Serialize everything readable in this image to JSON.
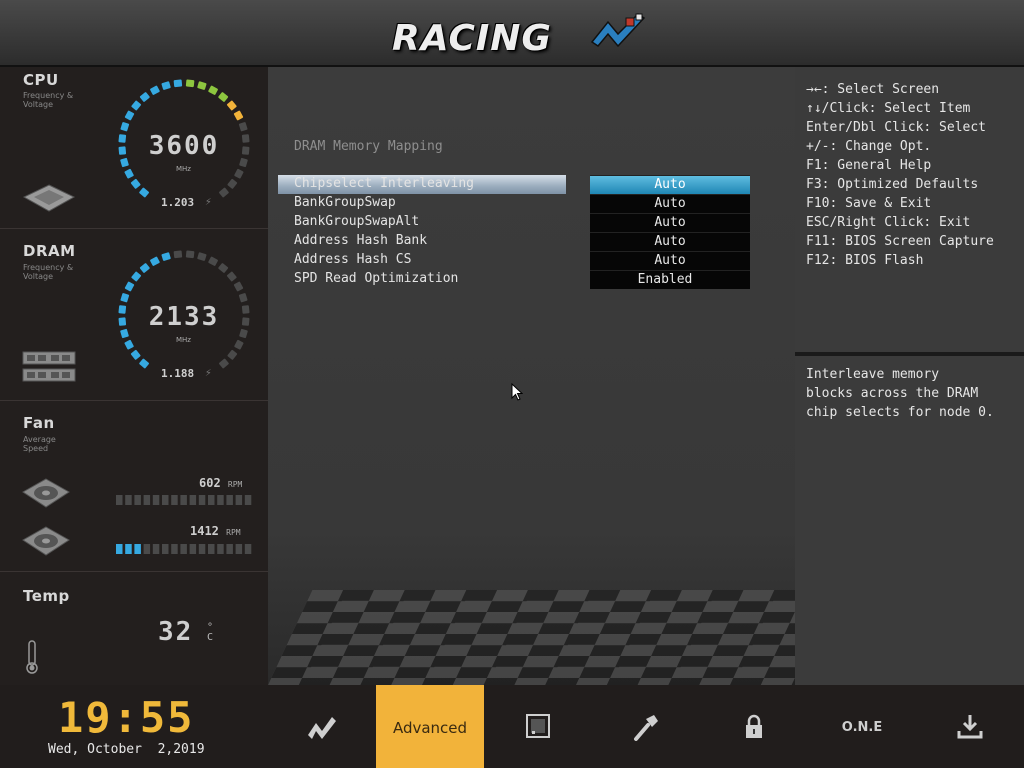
{
  "header": {
    "logo_text": "RACING",
    "logo_icon": "racing-flag-logo"
  },
  "sidebar": {
    "cpu": {
      "title": "CPU",
      "subtitle": "Frequency & Voltage",
      "value": "3600",
      "unit": "MHz",
      "voltage": "1.203",
      "level": 0.72
    },
    "dram": {
      "title": "DRAM",
      "subtitle": "Frequency & Voltage",
      "value": "2133",
      "unit": "MHz",
      "voltage": "1.188",
      "level": 0.45
    },
    "fan": {
      "title": "Fan",
      "subtitle": "Average Speed",
      "fans": [
        {
          "rpm": "602",
          "unit": "RPM",
          "level": 0.0
        },
        {
          "rpm": "1412",
          "unit": "RPM",
          "level": 0.2
        }
      ]
    },
    "temp": {
      "title": "Temp",
      "value": "32",
      "unit": "°C"
    }
  },
  "main": {
    "section_title": "DRAM Memory Mapping",
    "options": [
      {
        "label": "Chipselect Interleaving",
        "value": "Auto",
        "selected": true
      },
      {
        "label": "BankGroupSwap",
        "value": "Auto",
        "selected": false
      },
      {
        "label": "BankGroupSwapAlt",
        "value": "Auto",
        "selected": false
      },
      {
        "label": "Address Hash Bank",
        "value": "Auto",
        "selected": false
      },
      {
        "label": "Address Hash CS",
        "value": "Auto",
        "selected": false
      },
      {
        "label": "SPD Read Optimization",
        "value": "Enabled",
        "selected": false
      }
    ]
  },
  "help": {
    "lines": [
      "→←: Select Screen",
      "↑↓/Click: Select Item",
      "Enter/Dbl Click: Select",
      "+/-: Change Opt.",
      "F1: General Help",
      "F3: Optimized Defaults",
      "F10: Save & Exit",
      "ESC/Right Click: Exit",
      "F11: BIOS Screen Capture",
      "F12: BIOS Flash"
    ]
  },
  "description": {
    "lines": [
      "Interleave memory",
      "blocks across the DRAM",
      "chip selects for node 0."
    ]
  },
  "footer": {
    "time": "19:55",
    "date": "Wed, October  2,2019",
    "tabs": [
      {
        "name": "main",
        "label": "",
        "icon": "racing-logo-icon"
      },
      {
        "name": "advanced",
        "label": "Advanced",
        "icon": "",
        "active": true
      },
      {
        "name": "chipset",
        "label": "",
        "icon": "chip-icon"
      },
      {
        "name": "tools",
        "label": "",
        "icon": "hammer-icon"
      },
      {
        "name": "security",
        "label": "",
        "icon": "lock-icon"
      },
      {
        "name": "one",
        "label": "O.N.E",
        "icon": ""
      },
      {
        "name": "exit",
        "label": "",
        "icon": "download-icon"
      }
    ]
  },
  "colors": {
    "accent": "#f2b33a",
    "selection": "#2a93c2",
    "gauge_blue": "#36a9e1",
    "gauge_green": "#8dc63f",
    "gauge_yellow": "#f2b33a"
  }
}
